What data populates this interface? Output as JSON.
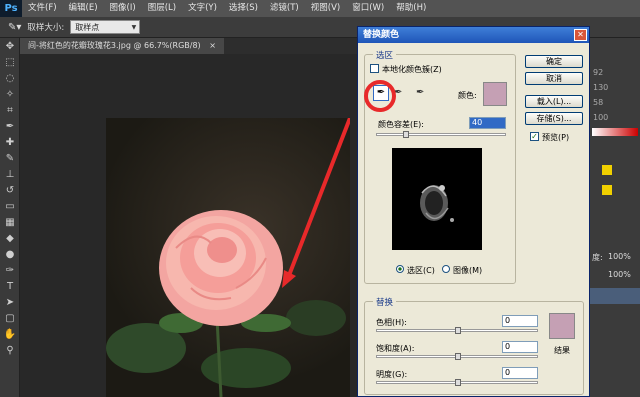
{
  "app": {
    "logo": "Ps"
  },
  "menu": [
    "文件(F)",
    "编辑(E)",
    "图像(I)",
    "图层(L)",
    "文字(Y)",
    "选择(S)",
    "滤镜(T)",
    "视图(V)",
    "窗口(W)",
    "帮助(H)"
  ],
  "options": {
    "sample_label": "取样大小:",
    "sample_value": "取样点"
  },
  "document": {
    "tab_title": "间-将红色的花瓣玫瑰花3.jpg @ 66.7%(RGB/8)",
    "close": "×"
  },
  "right_panel": {
    "values": [
      "92",
      "130",
      "58",
      "100"
    ],
    "opacity_label": "度:",
    "opacity_value": "100%",
    "fill_value": "100%"
  },
  "dialog": {
    "title": "替换颜色",
    "close": "✕",
    "selection_group": "选区",
    "localized_label": "本地化颜色簇(Z)",
    "color_label": "颜色:",
    "tolerance_label": "颜色容差(E):",
    "tolerance_value": "40",
    "radio_selection": "选区(C)",
    "radio_image": "图像(M)",
    "replace_group": "替换",
    "hue_label": "色相(H):",
    "hue_value": "0",
    "saturation_label": "饱和度(A):",
    "saturation_value": "0",
    "lightness_label": "明度(G):",
    "lightness_value": "0",
    "result_label": "结果",
    "ok": "确定",
    "cancel": "取消",
    "load": "载入(L)...",
    "save": "存储(S)...",
    "preview": "预览(P)",
    "selected_color": "#c5a0b4",
    "result_color": "#c5a0b4"
  }
}
